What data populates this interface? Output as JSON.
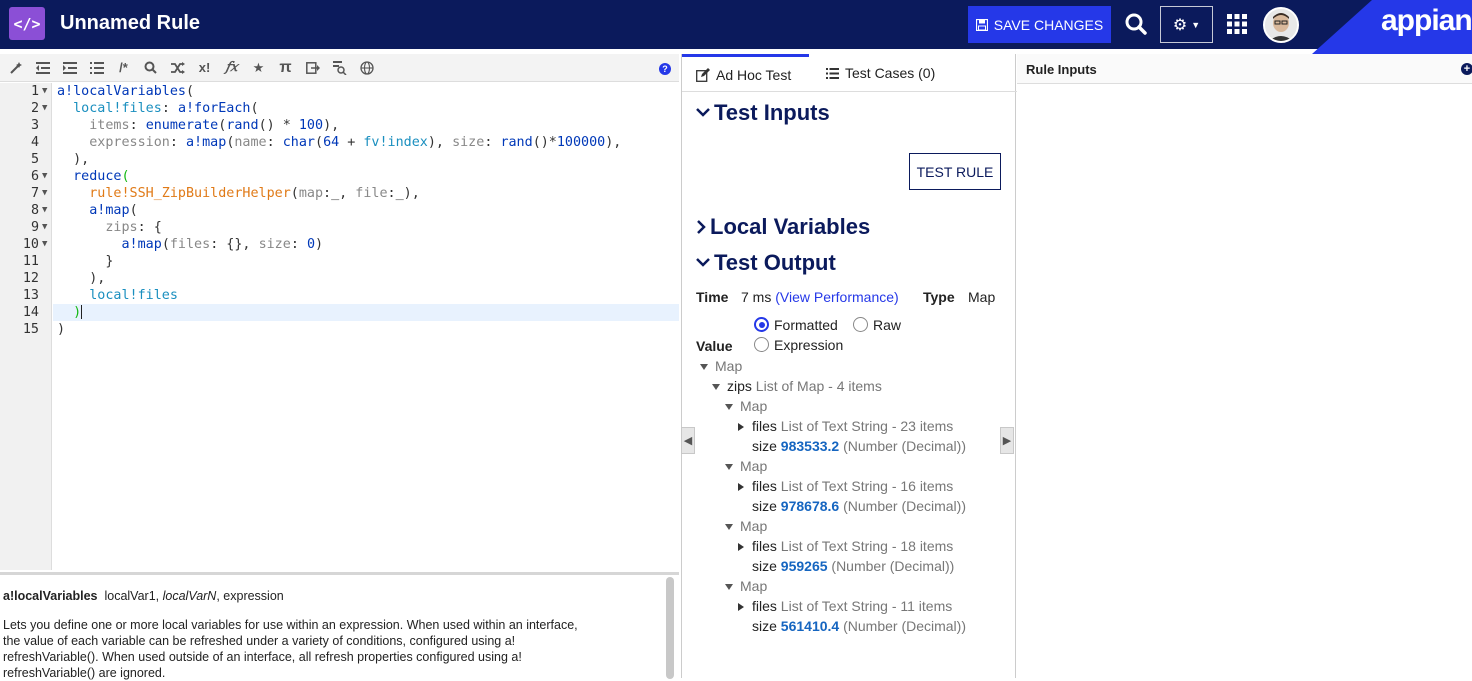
{
  "header": {
    "logo_glyph": "</>",
    "title": "Unnamed Rule",
    "save_label": "SAVE CHANGES",
    "brand": "appian",
    "icons": [
      "code-icon",
      "save-icon",
      "search-icon",
      "gear-icon",
      "chevron-down-icon",
      "apps-grid-icon",
      "avatar"
    ],
    "colors": {
      "header_bg": "#0b1a5c",
      "accent": "#2538e8",
      "logo_bg": "#8b4fd6"
    }
  },
  "toolbar": {
    "icons": [
      "format-icon",
      "outdent-icon",
      "indent-icon",
      "list-icon",
      "comment-icon",
      "search-icon",
      "shuffle-icon",
      "expression-icon",
      "function-icon",
      "star-icon",
      "pi-icon",
      "export-icon",
      "query-icon",
      "globe-icon",
      "help-icon"
    ],
    "help_glyph": "?",
    "comment_glyph": "/*",
    "x_glyph": "x!",
    "fx_glyph": "𝑓𝑥",
    "pi_glyph": "π"
  },
  "editor": {
    "lines": [
      {
        "n": "1",
        "fold": true
      },
      {
        "n": "2",
        "fold": true
      },
      {
        "n": "3",
        "fold": false
      },
      {
        "n": "4",
        "fold": false
      },
      {
        "n": "5",
        "fold": false
      },
      {
        "n": "6",
        "fold": true
      },
      {
        "n": "7",
        "fold": true
      },
      {
        "n": "8",
        "fold": true
      },
      {
        "n": "9",
        "fold": true
      },
      {
        "n": "10",
        "fold": true
      },
      {
        "n": "11",
        "fold": false
      },
      {
        "n": "12",
        "fold": false
      },
      {
        "n": "13",
        "fold": false
      },
      {
        "n": "14",
        "fold": false
      },
      {
        "n": "15",
        "fold": false
      }
    ],
    "code": {
      "l1_a": "a!localVariables",
      "l1_b": "(",
      "l2_a": "local!files",
      "l2_b": ": ",
      "l2_c": "a!forEach",
      "l2_d": "(",
      "l3_a": "items",
      "l3_b": ": ",
      "l3_c": "enumerate",
      "l3_d": "(",
      "l3_e": "rand",
      "l3_f": "() * ",
      "l3_g": "100",
      "l3_h": "),",
      "l4_a": "expression",
      "l4_b": ": ",
      "l4_c": "a!map",
      "l4_d": "(",
      "l4_e": "name",
      "l4_f": ": ",
      "l4_g": "char",
      "l4_h": "(",
      "l4_i": "64",
      "l4_j": " + ",
      "l4_k": "fv!index",
      "l4_l": "), ",
      "l4_m": "size",
      "l4_n": ": ",
      "l4_o": "rand",
      "l4_p": "()*",
      "l4_q": "100000",
      "l4_r": "),",
      "l5": "),",
      "l6_a": "reduce",
      "l6_b": "(",
      "l7_a": "rule!SSH_ZipBuilderHelper",
      "l7_b": "(",
      "l7_c": "map",
      "l7_d": ":_, ",
      "l7_e": "file",
      "l7_f": ":_),",
      "l8_a": "a!map",
      "l8_b": "(",
      "l9_a": "zips",
      "l9_b": ": {",
      "l10_a": "a!map",
      "l10_b": "(",
      "l10_c": "files",
      "l10_d": ": {}, ",
      "l10_e": "size",
      "l10_f": ": ",
      "l10_g": "0",
      "l10_h": ")",
      "l11": "}",
      "l12": "),",
      "l13": "local!files",
      "l14": ")",
      "l15": ")"
    }
  },
  "doc": {
    "fn_name": "a!localVariables",
    "args_a": "localVar1, ",
    "args_b": "localVarN",
    "args_c": ", expression",
    "desc_1": "Lets you define one or more local variables for use within an expression. When used within an interface,",
    "desc_2": "the value of each variable can be refreshed under a variety of conditions, configured using a!",
    "desc_3": "refreshVariable(). When used outside of an interface, all refresh properties configured using a!",
    "desc_4": "refreshVariable() are ignored."
  },
  "test_panel": {
    "tabs": [
      {
        "label": "Ad Hoc Test",
        "icon": "edit-icon",
        "active": true
      },
      {
        "label": "Test Cases (0)",
        "icon": "list-icon",
        "active": false
      }
    ],
    "test_inputs_heading": "Test Inputs",
    "test_rule_label": "TEST RULE",
    "local_vars_heading": "Local Variables",
    "test_output_heading": "Test Output",
    "time_label": "Time",
    "time_value": "7 ms",
    "view_perf": "(View Performance)",
    "type_label": "Type",
    "type_value": "Map",
    "value_label": "Value",
    "radio_options": [
      {
        "label": "Formatted",
        "selected": true
      },
      {
        "label": "Raw",
        "selected": false
      },
      {
        "label": "Expression",
        "selected": false
      }
    ],
    "tree": {
      "root": "Map",
      "zips_key": "zips",
      "zips_desc": "List of Map - 4 items",
      "maps": [
        {
          "label": "Map",
          "files_key": "files",
          "files_desc": "List of Text String - 23 items",
          "size_key": "size",
          "size_value": "983533.2",
          "size_type": "(Number (Decimal))"
        },
        {
          "label": "Map",
          "files_key": "files",
          "files_desc": "List of Text String - 16 items",
          "size_key": "size",
          "size_value": "978678.6",
          "size_type": "(Number (Decimal))"
        },
        {
          "label": "Map",
          "files_key": "files",
          "files_desc": "List of Text String - 18 items",
          "size_key": "size",
          "size_value": "959265",
          "size_type": "(Number (Decimal))"
        },
        {
          "label": "Map",
          "files_key": "files",
          "files_desc": "List of Text String - 11 items",
          "size_key": "size",
          "size_value": "561410.4",
          "size_type": "(Number (Decimal))"
        }
      ]
    }
  },
  "rule_inputs": {
    "title": "Rule Inputs",
    "add_glyph": "+"
  }
}
